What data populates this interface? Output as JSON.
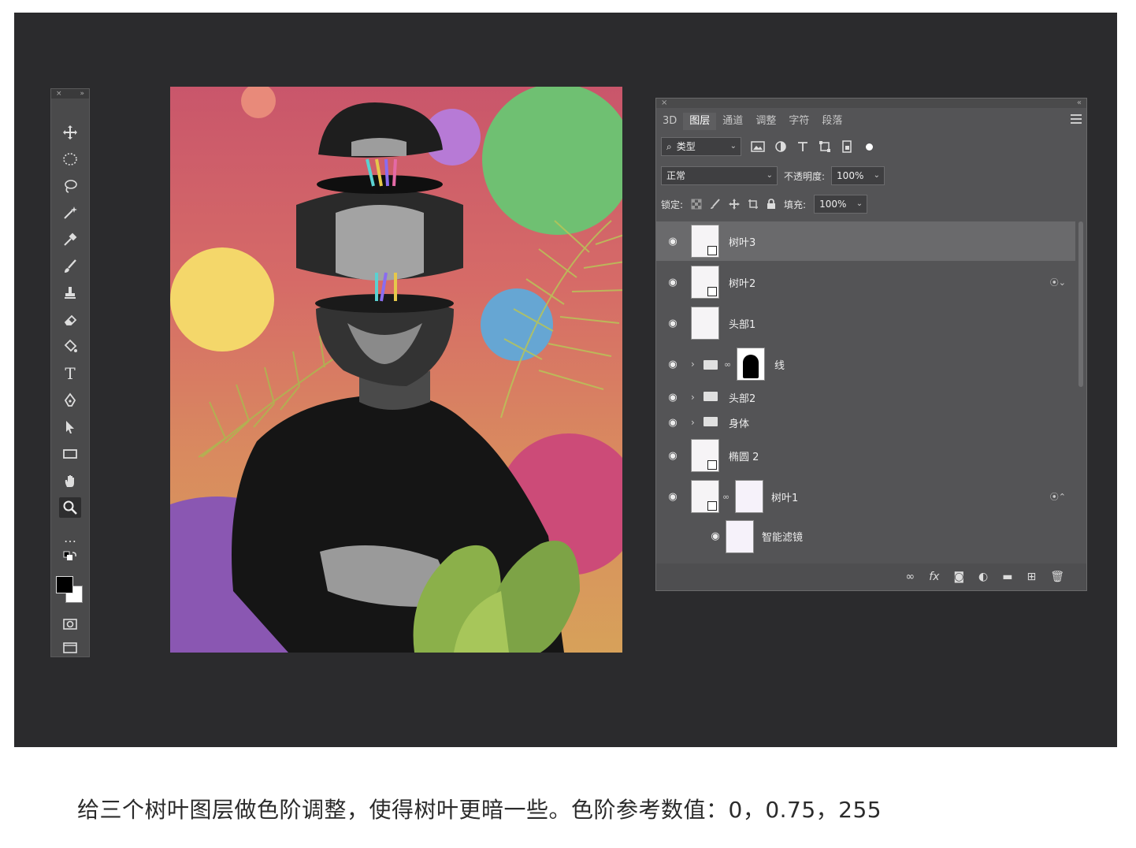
{
  "toolbar": {
    "close_glyph": "×",
    "collapse_glyph": "»",
    "tools": [
      "move-tool",
      "elliptical-marquee-tool",
      "lasso-tool",
      "magic-wand-tool",
      "eyedropper-tool",
      "brush-tool",
      "clone-stamp-tool",
      "eraser-tool",
      "paint-bucket-tool",
      "type-tool",
      "pen-tool",
      "path-selection-tool",
      "rectangle-tool",
      "hand-tool",
      "zoom-tool",
      "more-tools",
      "default-colors",
      "quick-mask",
      "screen-mode"
    ],
    "type_glyph": "T",
    "more_glyph": "…"
  },
  "panel": {
    "close_glyph": "×",
    "collapse_glyph": "«",
    "tabs": [
      "3D",
      "图层",
      "通道",
      "调整",
      "字符",
      "段落"
    ],
    "active_tab": "图层",
    "filter": {
      "search_glyph": "⌕",
      "label": "类型"
    },
    "filter_icons": [
      "image-filter-icon",
      "adjustment-filter-icon",
      "type-filter-icon",
      "shape-filter-icon",
      "smart-object-filter-icon"
    ],
    "blend_mode": "正常",
    "opacity_label": "不透明度:",
    "opacity_value": "100%",
    "lock_label": "锁定:",
    "fill_label": "填充:",
    "fill_value": "100%",
    "layers": [
      {
        "name": "树叶3",
        "selected": true
      },
      {
        "name": "树叶2"
      },
      {
        "name": "头部1"
      },
      {
        "name": "线"
      },
      {
        "name": "头部2"
      },
      {
        "name": "身体"
      },
      {
        "name": "椭圆 2"
      },
      {
        "name": "树叶1"
      },
      {
        "name": "智能滤镜"
      }
    ],
    "bottom_icons": [
      "link-layers-icon",
      "fx-icon",
      "mask-icon",
      "adjustment-layer-icon",
      "group-icon",
      "new-layer-icon",
      "trash-icon"
    ],
    "fx_label": "fx"
  },
  "caption": "给三个树叶图层做色阶调整，使得树叶更暗一些。色阶参考数值：0，0.75，255",
  "colors": {
    "stage": "#2b2b2d",
    "panel": "#545456",
    "toolbar": "#4a4a4b",
    "canvas_top": "#c9566b",
    "canvas_bottom": "#d7a15a"
  }
}
